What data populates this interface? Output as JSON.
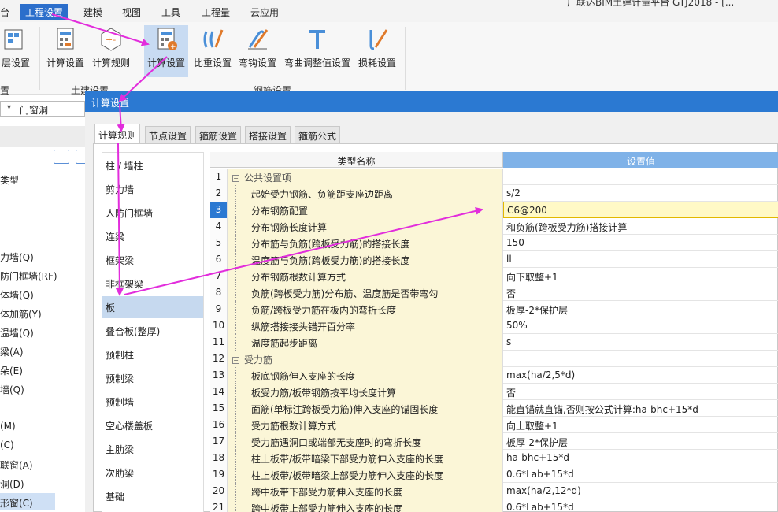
{
  "title_right": "广联达BIM土建计量平台 GTJ2018 - [...",
  "menu": [
    "台",
    "工程设置",
    "建模",
    "视图",
    "工具",
    "工程量",
    "云应用"
  ],
  "ribbon": {
    "btn_floor": "层设置",
    "btn_calc_setting_1": "计算设置",
    "btn_calc_rule": "计算规则",
    "btn_calc_setting_2": "计算设置",
    "btn_weight": "比重设置",
    "btn_hook": "弯钩设置",
    "btn_bend": "弯曲调整值设置",
    "btn_loss": "损耗设置",
    "group_left": "置",
    "group_civil": "土建设置",
    "group_rebar": "钢筋设置"
  },
  "left": {
    "combo_value": "门窗洞",
    "type_label": "类型",
    "items": [
      "力墙(Q)",
      "防门框墙(RF)",
      "体墙(Q)",
      "体加筋(Y)",
      "温墙(Q)",
      "梁(A)",
      "朵(E)",
      "墙(Q)",
      "(M)",
      "(C)",
      "联窗(A)",
      "洞(D)",
      "形窗(C)"
    ]
  },
  "dialog": {
    "title": "计算设置",
    "tabs": [
      "计算规则",
      "节点设置",
      "箍筋设置",
      "搭接设置",
      "箍筋公式"
    ],
    "categories": [
      "柱 / 墙柱",
      "剪力墙",
      "人防门框墙",
      "连梁",
      "框架梁",
      "非框架梁",
      "板",
      "叠合板(整厚)",
      "预制柱",
      "预制梁",
      "预制墙",
      "空心楼盖板",
      "主肋梁",
      "次肋梁",
      "基础"
    ],
    "grid_header": {
      "name": "类型名称",
      "value": "设置值"
    },
    "rows": [
      {
        "n": "1",
        "name": "公共设置项",
        "value": "",
        "group": true
      },
      {
        "n": "2",
        "name": "起始受力钢筋、负筋距支座边距离",
        "value": "s/2"
      },
      {
        "n": "3",
        "name": "分布钢筋配置",
        "value": "C6@200",
        "current": true
      },
      {
        "n": "4",
        "name": "分布钢筋长度计算",
        "value": "和负筋(跨板受力筋)搭接计算"
      },
      {
        "n": "5",
        "name": "分布筋与负筋(跨板受力筋)的搭接长度",
        "value": "150"
      },
      {
        "n": "6",
        "name": "温度筋与负筋(跨板受力筋)的搭接长度",
        "value": "ll"
      },
      {
        "n": "7",
        "name": "分布钢筋根数计算方式",
        "value": "向下取整+1"
      },
      {
        "n": "8",
        "name": "负筋(跨板受力筋)分布筋、温度筋是否带弯勾",
        "value": "否"
      },
      {
        "n": "9",
        "name": "负筋/跨板受力筋在板内的弯折长度",
        "value": "板厚-2*保护层"
      },
      {
        "n": "10",
        "name": "纵筋搭接接头错开百分率",
        "value": "50%"
      },
      {
        "n": "11",
        "name": "温度筋起步距离",
        "value": "s"
      },
      {
        "n": "12",
        "name": "受力筋",
        "value": "",
        "group": true
      },
      {
        "n": "13",
        "name": "板底钢筋伸入支座的长度",
        "value": "max(ha/2,5*d)"
      },
      {
        "n": "14",
        "name": "板受力筋/板带钢筋按平均长度计算",
        "value": "否"
      },
      {
        "n": "15",
        "name": "面筋(单标注跨板受力筋)伸入支座的锚固长度",
        "value": "能直锚就直锚,否则按公式计算:ha-bhc+15*d"
      },
      {
        "n": "16",
        "name": "受力筋根数计算方式",
        "value": "向上取整+1"
      },
      {
        "n": "17",
        "name": "受力筋遇洞口或端部无支座时的弯折长度",
        "value": "板厚-2*保护层"
      },
      {
        "n": "18",
        "name": "柱上板带/板带暗梁下部受力筋伸入支座的长度",
        "value": "ha-bhc+15*d"
      },
      {
        "n": "19",
        "name": "柱上板带/板带暗梁上部受力筋伸入支座的长度",
        "value": "0.6*Lab+15*d"
      },
      {
        "n": "20",
        "name": "跨中板带下部受力筋伸入支座的长度",
        "value": "max(ha/2,12*d)"
      },
      {
        "n": "21",
        "name": "跨中板带上部受力筋伸入支座的长度",
        "value": "0.6*Lab+15*d"
      }
    ]
  },
  "colors": {
    "accent": "#2b79d2",
    "arrow": "#e22ddc",
    "name_cell": "#fbf6d7",
    "selected": "#c6d9ef"
  }
}
